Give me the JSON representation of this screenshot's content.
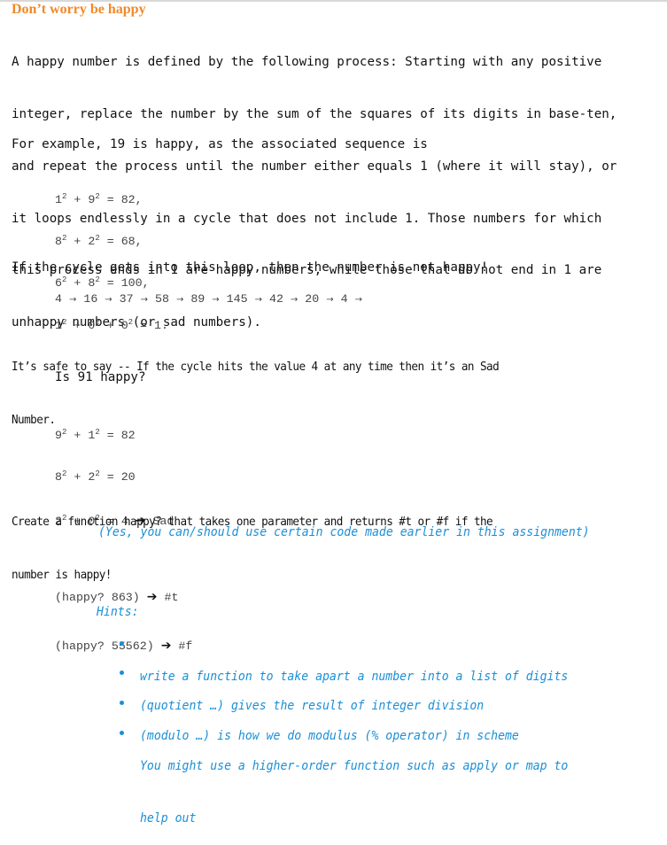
{
  "title": "Don’t worry be happy",
  "intro": {
    "lines": [
      "A happy number is defined by the following process: Starting with any positive",
      "integer, replace the number by the sum of the squares of its digits in base-ten,",
      "and repeat the process until the number either equals 1 (where it will stay), or",
      "it loops endlessly in a cycle that does not include 1. Those numbers for which",
      "this process ends in 1 are happy numbers, while those that do not end in 1 are",
      "unhappy numbers (or sad numbers)."
    ]
  },
  "example": {
    "intro": "For example, 19 is happy, as the associated sequence is",
    "steps": [
      {
        "terms": [
          "1",
          "9"
        ],
        "result": "82,"
      },
      {
        "terms": [
          "8",
          "2"
        ],
        "result": "68,"
      },
      {
        "terms": [
          "6",
          "8"
        ],
        "result": "100,"
      },
      {
        "terms": [
          "1",
          "0",
          "0"
        ],
        "result": "1."
      }
    ]
  },
  "loop": {
    "intro": "If the cycle gets into this loop, then the number is not happy!",
    "sequence": [
      "4",
      "16",
      "37",
      "58",
      "89",
      "145",
      "42",
      "20",
      "4"
    ],
    "arrow": "→"
  },
  "safe": {
    "lines": [
      "It’s safe to say -- If the cycle hits the value 4 at any time then it’s an Sad",
      "Number."
    ]
  },
  "sad_example": {
    "question": "Is 91 happy?",
    "steps": [
      {
        "terms": [
          "9",
          "1"
        ],
        "result": "82",
        "suffix": ""
      },
      {
        "terms": [
          "8",
          "2"
        ],
        "result": "20",
        "suffix": ""
      },
      {
        "terms": [
          "2",
          "0"
        ],
        "result": "4",
        "suffix": "Sad"
      }
    ],
    "arrow": "➔"
  },
  "task": {
    "lines": [
      "Create a function happy? that takes one parameter and returns #t or #f if the",
      "number is happy!"
    ],
    "note": "(Yes, you can/should use certain code made earlier in this assignment)",
    "examples": [
      {
        "call": "(happy? 863)",
        "result": "#t"
      },
      {
        "call": "(happy? 55562)",
        "result": "#f"
      }
    ],
    "arrow": "➔"
  },
  "hints": {
    "label": "Hints:",
    "items": [
      [
        "write a function to take apart a number into a list of digits"
      ],
      [
        "(quotient …) gives the result of integer division"
      ],
      [
        "(modulo …) is how we do modulus (% operator) in scheme"
      ],
      [
        "You might use a higher-order function such as apply or map to",
        "help out"
      ]
    ]
  },
  "colors": {
    "title": "#f0892a",
    "hint_blue": "#1a8fd6",
    "body_text": "#111111",
    "code_text": "#444444"
  }
}
